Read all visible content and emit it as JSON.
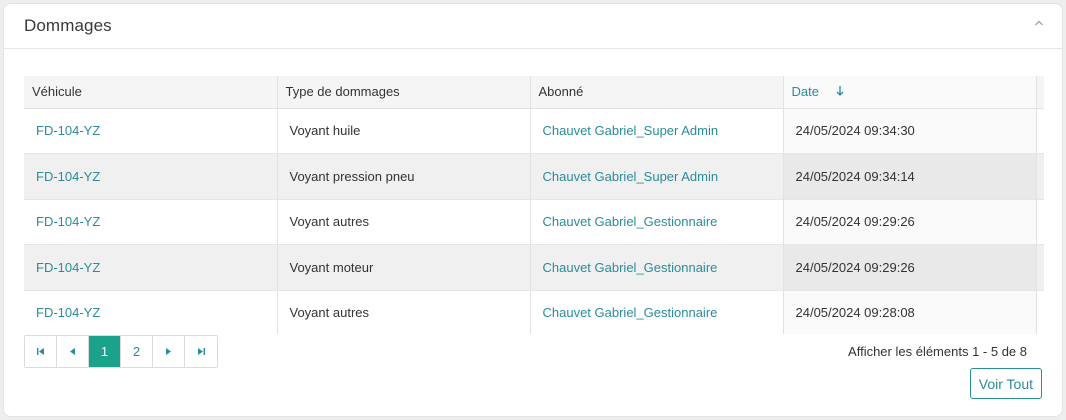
{
  "card": {
    "title": "Dommages"
  },
  "table": {
    "columns": [
      "Véhicule",
      "Type de dommages",
      "Abonné",
      "Date"
    ],
    "sorted_column": "Date",
    "sort_direction": "descending",
    "rows": [
      {
        "vehicule": "FD-104-YZ",
        "type": "Voyant huile",
        "abonne": "Chauvet Gabriel_Super Admin",
        "date": "24/05/2024 09:34:30"
      },
      {
        "vehicule": "FD-104-YZ",
        "type": "Voyant pression pneu",
        "abonne": "Chauvet Gabriel_Super Admin",
        "date": "24/05/2024 09:34:14"
      },
      {
        "vehicule": "FD-104-YZ",
        "type": "Voyant autres",
        "abonne": "Chauvet Gabriel_Gestionnaire",
        "date": "24/05/2024 09:29:26"
      },
      {
        "vehicule": "FD-104-YZ",
        "type": "Voyant moteur",
        "abonne": "Chauvet Gabriel_Gestionnaire",
        "date": "24/05/2024 09:29:26"
      },
      {
        "vehicule": "FD-104-YZ",
        "type": "Voyant autres",
        "abonne": "Chauvet Gabriel_Gestionnaire",
        "date": "24/05/2024 09:28:08"
      }
    ]
  },
  "pager": {
    "pages": [
      "1",
      "2"
    ],
    "current_page": "1",
    "info": "Afficher les éléments 1 - 5 de 8"
  },
  "actions": {
    "view_all_label": "Voir Tout"
  },
  "colors": {
    "accent": "#2a8c9a",
    "active_page": "#1aa28c"
  }
}
